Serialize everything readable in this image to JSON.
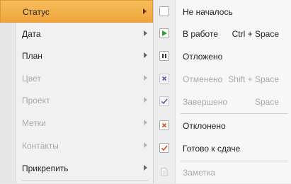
{
  "left_menu": {
    "items": [
      {
        "label": "Статус",
        "state": "active"
      },
      {
        "label": "Дата",
        "state": "enabled"
      },
      {
        "label": "План",
        "state": "enabled"
      },
      {
        "label": "Цвет",
        "state": "disabled"
      },
      {
        "label": "Проект",
        "state": "disabled"
      },
      {
        "label": "Метки",
        "state": "disabled"
      },
      {
        "label": "Контакты",
        "state": "disabled"
      },
      {
        "label": "Прикрепить",
        "state": "enabled"
      }
    ]
  },
  "status_menu": {
    "items": [
      {
        "label": "Не началось",
        "shortcut": "",
        "icon": "empty-checkbox-icon",
        "state": "enabled"
      },
      {
        "label": "В работе",
        "shortcut": "Ctrl + Space",
        "icon": "play-icon",
        "state": "enabled",
        "icon_color": "#2ea12e"
      },
      {
        "label": "Отложено",
        "shortcut": "",
        "icon": "pause-icon",
        "state": "enabled"
      },
      {
        "label": "Отменено",
        "shortcut": "Shift + Space",
        "icon": "cancel-x-icon",
        "state": "disabled",
        "icon_color": "#5b5fa8"
      },
      {
        "label": "Завершено",
        "shortcut": "Space",
        "icon": "checkmark-icon",
        "state": "disabled",
        "icon_color": "#5b5fa8"
      },
      {
        "label": "Отклонено",
        "shortcut": "",
        "icon": "reject-x-icon",
        "state": "enabled",
        "icon_color": "#e0502a"
      },
      {
        "label": "Готово к сдаче",
        "shortcut": "",
        "icon": "ready-checkmark-icon",
        "state": "enabled",
        "icon_color": "#e0502a"
      },
      {
        "label": "Заметка",
        "shortcut": "",
        "icon": "note-icon",
        "state": "disabled"
      }
    ]
  },
  "colors": {
    "highlight": "#f2ac45",
    "menu_background": "#f1f1f1",
    "disabled_text": "#a9a9a9"
  }
}
